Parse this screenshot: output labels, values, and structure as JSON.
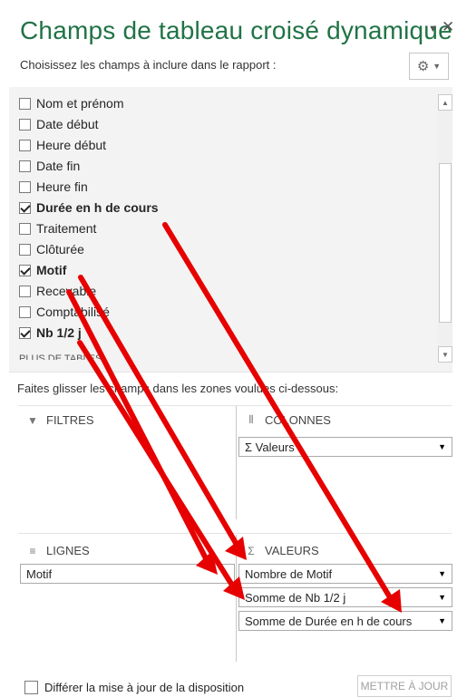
{
  "panel": {
    "title": "Champs de tableau croisé dynamique",
    "subtitle": "Choisissez les champs à inclure dans le rapport :",
    "more_tables": "PLUS DE TABLES"
  },
  "fields": [
    {
      "label": "Nom et prénom",
      "checked": false
    },
    {
      "label": "Date début",
      "checked": false
    },
    {
      "label": "Heure début",
      "checked": false
    },
    {
      "label": "Date fin",
      "checked": false
    },
    {
      "label": "Heure fin",
      "checked": false
    },
    {
      "label": "Durée en h de cours",
      "checked": true
    },
    {
      "label": "Traitement",
      "checked": false
    },
    {
      "label": "Clôturée",
      "checked": false
    },
    {
      "label": "Motif",
      "checked": true
    },
    {
      "label": "Recevable",
      "checked": false
    },
    {
      "label": "Comptabilisé",
      "checked": false
    },
    {
      "label": "Nb 1/2 j",
      "checked": true
    }
  ],
  "areas": {
    "instruction": "Faites glisser les champs dans les zones voulues ci-dessous:",
    "filters": {
      "label": "FILTRES",
      "icon": "filter-icon"
    },
    "columns": {
      "label": "COLONNES",
      "icon": "columns-icon",
      "items": [
        "Σ Valeurs"
      ]
    },
    "rows": {
      "label": "LIGNES",
      "icon": "rows-icon",
      "items": [
        "Motif"
      ]
    },
    "values": {
      "label": "VALEURS",
      "icon": "sigma-icon",
      "items": [
        "Nombre de Motif",
        "Somme de Nb 1/2 j",
        "Somme de Durée en h de cours"
      ]
    }
  },
  "footer": {
    "defer_label": "Différer la mise à jour de la disposition",
    "update_button": "METTRE À JOUR"
  },
  "colors": {
    "title": "#217346",
    "arrow": "#e60000",
    "panel_bg": "#f3f3f3"
  }
}
